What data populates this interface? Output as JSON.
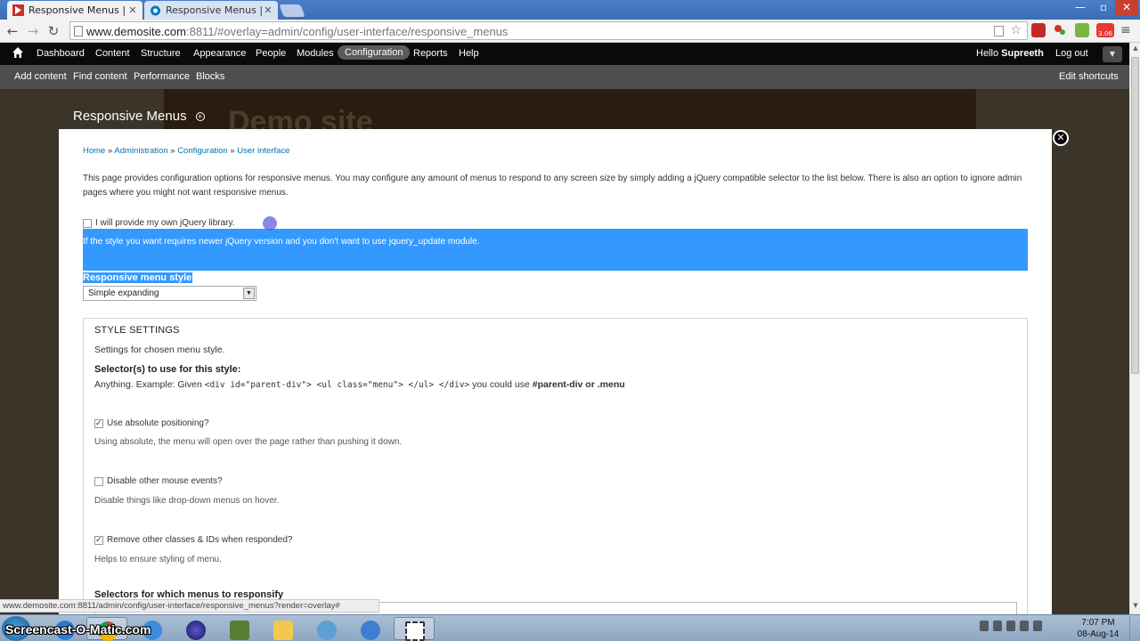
{
  "browser": {
    "tabs": [
      {
        "title": "Responsive Menus | Demo site",
        "active": true
      },
      {
        "title": "Responsive Menus | Drupal.org",
        "active": false
      }
    ],
    "window_controls": [
      "—",
      "▫",
      "✕"
    ],
    "url": {
      "host": "www.demosite.com",
      "rest": ":8811/#overlay=admin/config/user-interface/responsive_menus"
    },
    "extension_badge": "3.06"
  },
  "admin_toolbar": {
    "items": [
      "Dashboard",
      "Content",
      "Structure",
      "Appearance",
      "People",
      "Modules",
      "Configuration",
      "Reports",
      "Help"
    ],
    "active": "Configuration",
    "greeting": "Hello",
    "username": "Supreeth",
    "logout": "Log out"
  },
  "shortcuts": {
    "items": [
      "Add content",
      "Find content",
      "Performance",
      "Blocks"
    ],
    "edit": "Edit shortcuts"
  },
  "backdrop": {
    "site_name": "Demo site"
  },
  "overlay": {
    "title": "Responsive Menus",
    "close": "✕",
    "breadcrumb": [
      "Home",
      "Administration",
      "Configuration",
      "User interface"
    ],
    "breadcrumb_sep": "»",
    "intro": "This page provides configuration options for responsive menus. You may configure any amount of menus to respond to any screen size by simply adding a jQuery compatible selector to the list below. There is also an option to ignore admin pages where you might not want responsive menus.",
    "jquery_checkbox": {
      "label": "I will provide my own jQuery library.",
      "checked": false
    },
    "jquery_desc": "If the style you want requires newer jQuery version and you don't want to use jquery_update module.",
    "style_label": "Responsive menu style",
    "style_select": {
      "value": "Simple expanding"
    },
    "style_settings": {
      "legend": "STYLE SETTINGS",
      "intro": "Settings for chosen menu style.",
      "selector_label": "Selector(s) to use for this style:",
      "selector_desc_prefix": "Anything. Example: Given",
      "selector_code": "<div id=\"parent-div\"> <ul class=\"menu\"> </ul> </div>",
      "selector_desc_mid": "you could use",
      "selector_example": "#parent-div or .menu",
      "options": [
        {
          "label": "Use absolute positioning?",
          "checked": true,
          "desc": "Using absolute, the menu will open over the page rather than pushing it down."
        },
        {
          "label": "Disable other mouse events?",
          "checked": false,
          "desc": "Disable things like drop-down menus on hover."
        },
        {
          "label": "Remove other classes & IDs when responded?",
          "checked": true,
          "desc": "Helps to ensure styling of menu."
        }
      ],
      "menus_label": "Selectors for which menus to responsify"
    }
  },
  "status_url": "www.demosite.com:8811/admin/config/user-interface/responsive_menus?render=overlay#",
  "taskbar": {
    "watermark": "Screencast-O-Matic.com",
    "time": "7:07 PM",
    "date": "08-Aug-14"
  },
  "colors": {
    "selection": "#3399ff",
    "admin_bar": "#0a0a0a",
    "link": "#0071b3"
  }
}
